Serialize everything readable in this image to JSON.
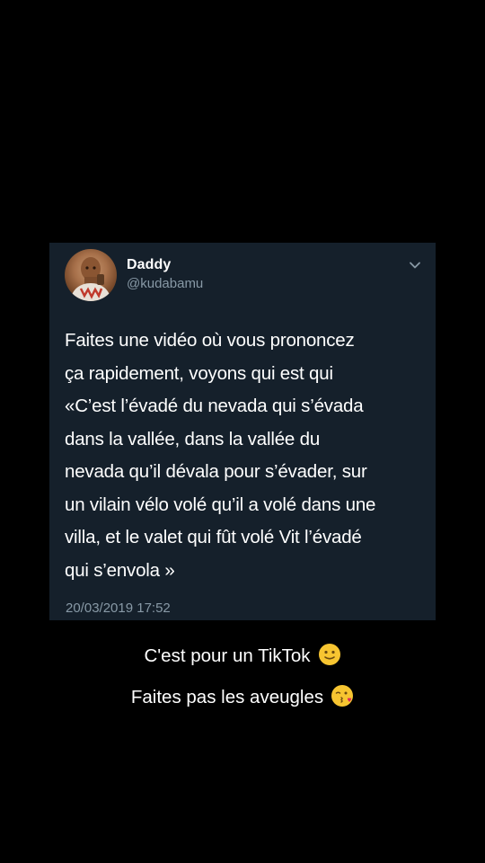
{
  "tweet": {
    "display_name": "Daddy",
    "handle": "@kudabamu",
    "text_lines": [
      "Faites une vidéo où vous prononcez",
      "ça rapidement, voyons qui est qui",
      "«C’est l’évadé du nevada qui s’évada",
      "dans la vallée, dans la vallée du",
      "nevada qu’il dévala pour s’évader, sur",
      "un vilain vélo volé qu’il a volé dans une",
      "villa, et le valet qui fût volé Vit l’évadé",
      "qui s’envola »"
    ],
    "timestamp": "20/03/2019 17:52",
    "menu_icon": "chevron-down-icon",
    "card_color": "#15202b",
    "secondary_text_color": "#8899a6"
  },
  "captions": {
    "line1": "C'est pour un TikTok",
    "line1_emoji": "slightly-smiling-face-emoji",
    "line2": "Faites pas les aveugles",
    "line2_emoji": "face-blowing-kiss-emoji"
  },
  "background_color": "#000000"
}
